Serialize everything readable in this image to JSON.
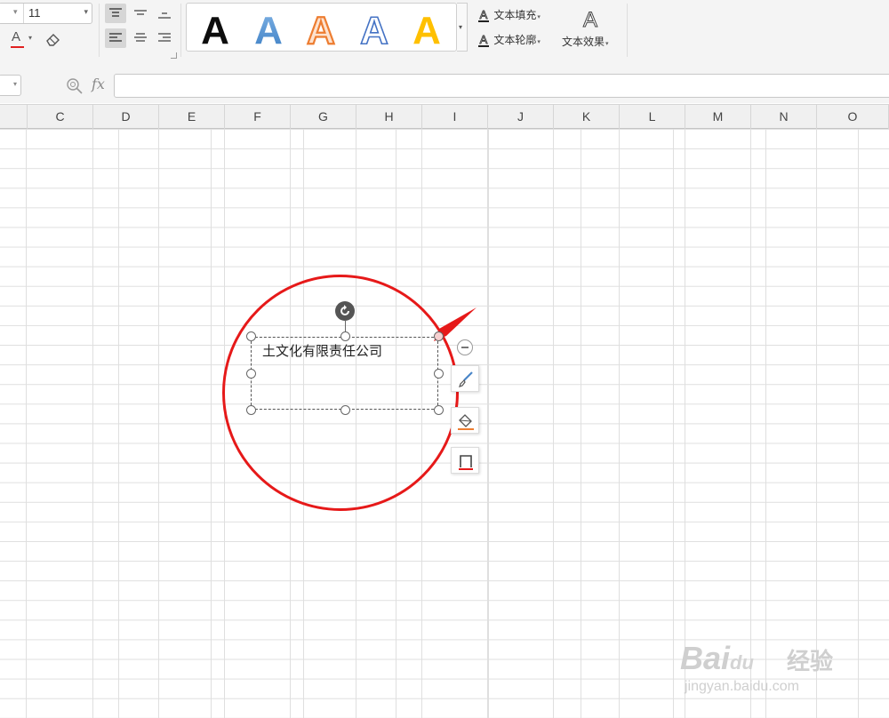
{
  "ribbon": {
    "font_size": "11",
    "font_color_letter": "A",
    "wordart_styles": [
      {
        "letter": "A",
        "style": "black-solid",
        "color": "#0d0d0d"
      },
      {
        "letter": "A",
        "style": "blue-gradient",
        "color": "#5b9bd5"
      },
      {
        "letter": "A",
        "style": "orange-outline",
        "color": "#ed7d31"
      },
      {
        "letter": "A",
        "style": "blue-outline",
        "color": "#4472c4"
      },
      {
        "letter": "A",
        "style": "gold-solid",
        "color": "#ffc000"
      }
    ],
    "text_fill_label": "文本填充",
    "text_outline_label": "文本轮廓",
    "text_effects_label": "文本效果"
  },
  "formula_bar": {
    "fx_label": "fx",
    "formula_value": ""
  },
  "columns": [
    "C",
    "D",
    "E",
    "F",
    "G",
    "H",
    "I",
    "J",
    "K",
    "L",
    "M",
    "N",
    "O"
  ],
  "textbox": {
    "text": "土文化有限责任公司"
  },
  "annotation": {
    "circle_color": "#e61919"
  },
  "quick_tools": [
    {
      "icon": "paintbrush-icon"
    },
    {
      "icon": "paint-bucket-fill-icon"
    },
    {
      "icon": "shape-outline-icon"
    }
  ],
  "watermark": {
    "brand": "Bai",
    "paw": "du",
    "cn": "经验",
    "url": "jingyan.baidu.com"
  }
}
